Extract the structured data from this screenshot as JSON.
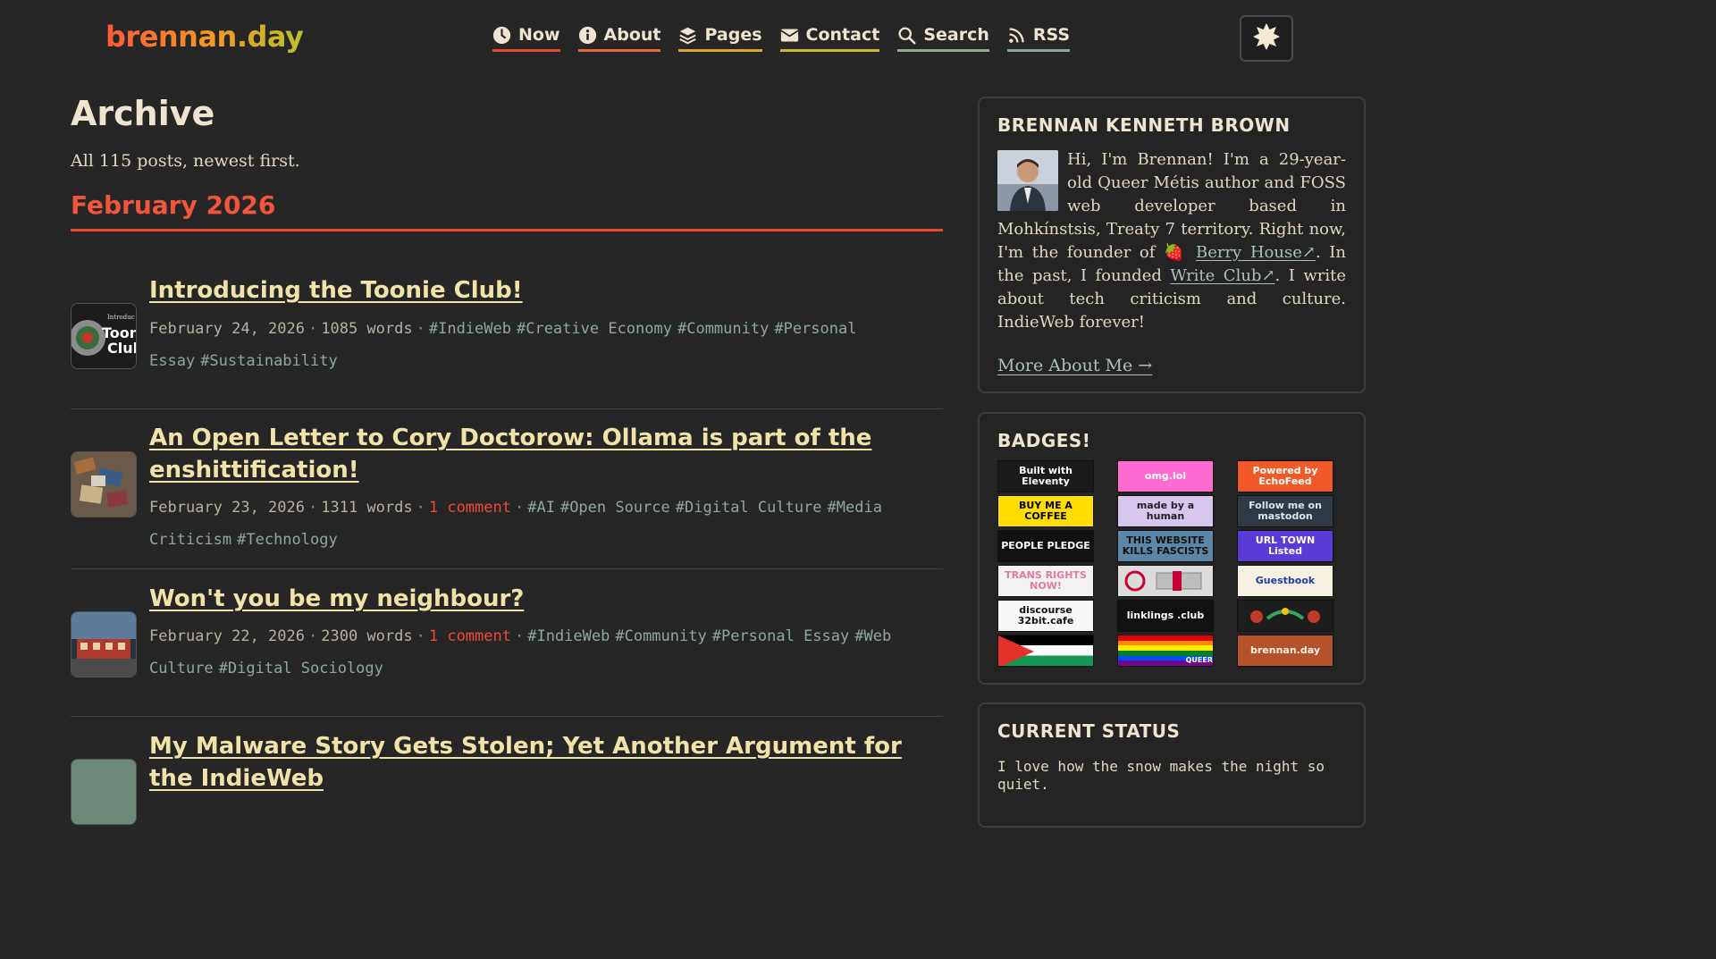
{
  "site": {
    "logo": "brennan.day"
  },
  "nav": [
    {
      "label": "Now",
      "icon": "clock-icon",
      "color": "#e8492d"
    },
    {
      "label": "About",
      "icon": "info-icon",
      "color": "#e8692d"
    },
    {
      "label": "Pages",
      "icon": "layers-icon",
      "color": "#e0a52b"
    },
    {
      "label": "Contact",
      "icon": "envelope-icon",
      "color": "#c6b92f"
    },
    {
      "label": "Search",
      "icon": "search-icon",
      "color": "#8fb08a"
    },
    {
      "label": "RSS",
      "icon": "rss-icon",
      "color": "#8aa6a2"
    }
  ],
  "theme_toggle": {
    "icon": "sun-icon"
  },
  "archive": {
    "title": "Archive",
    "intro": "All 115 posts, newest first.",
    "month": "February 2026",
    "posts": [
      {
        "title": "Introducing the Toonie Club!",
        "date": "February 24, 2026",
        "words": "1085 words",
        "comment": "",
        "tags": [
          "#IndieWeb",
          "#Creative Economy",
          "#Community",
          "#Personal Essay",
          "#Sustainability"
        ],
        "thumb_text": "Toon Club"
      },
      {
        "title": "An Open Letter to Cory Doctorow: Ollama is part of the enshittification!",
        "date": "February 23, 2026",
        "words": "1311 words",
        "comment": "1 comment",
        "tags": [
          "#AI",
          "#Open Source",
          "#Digital Culture",
          "#Media Criticism",
          "#Technology"
        ],
        "thumb_text": ""
      },
      {
        "title": "Won't you be my neighbour?",
        "date": "February 22, 2026",
        "words": "2300 words",
        "comment": "1 comment",
        "tags": [
          "#IndieWeb",
          "#Community",
          "#Personal Essay",
          "#Web Culture",
          "#Digital Sociology"
        ],
        "thumb_text": ""
      },
      {
        "title": "My Malware Story Gets Stolen; Yet Another Argument for the IndieWeb",
        "date": "",
        "words": "",
        "comment": "",
        "tags": [],
        "thumb_text": ""
      }
    ]
  },
  "sidebar": {
    "about": {
      "title": "BRENNAN KENNETH BROWN",
      "bio_1": "Hi, I'm Brennan! I'm a 29-year-old Queer Métis author and FOSS web developer based in Mohkínstsis, Treaty 7 territory. Right now, I'm the founder of ",
      "berry_emoji": "🍓",
      "berry_link": "Berry House↗",
      "bio_2": ". In the past, I founded ",
      "write_link": "Write Club↗",
      "bio_3": ". I write about tech criticism and culture. IndieWeb forever!",
      "more_link": "More About Me →"
    },
    "badges": {
      "title": "BADGES!",
      "items": [
        {
          "label": "Built with Eleventy",
          "bg": "#1a1a1a",
          "fg": "#ffffff"
        },
        {
          "label": "omg.lol",
          "bg": "#ff6bd0",
          "fg": "#ffffff"
        },
        {
          "label": "Powered by EchoFeed",
          "bg": "#f05a28",
          "fg": "#ffffff"
        },
        {
          "label": "BUY ME A COFFEE",
          "bg": "#ffdd00",
          "fg": "#000000"
        },
        {
          "label": "made by a human",
          "bg": "#d7c6ee",
          "fg": "#222222"
        },
        {
          "label": "Follow me on mastodon",
          "bg": "#2f3a44",
          "fg": "#dbe6ee"
        },
        {
          "label": "PEOPLE PLEDGE",
          "bg": "#111111",
          "fg": "#ffffff"
        },
        {
          "label": "THIS WEBSITE KILLS FASCISTS",
          "bg": "#5b86a8",
          "fg": "#111111"
        },
        {
          "label": "URL TOWN Listed",
          "bg": "#5a3bd6",
          "fg": "#ffffff"
        },
        {
          "label": "TRANS RIGHTS NOW!",
          "bg": "#f2f2f2",
          "fg": "#e07aa0"
        },
        {
          "label": "",
          "bg": "#dcdcdc",
          "fg": "#b01c3a"
        },
        {
          "label": "Guestbook",
          "bg": "#f5f0e0",
          "fg": "#1f3ea8"
        },
        {
          "label": "discourse 32bit.cafe",
          "bg": "#f8f8f8",
          "fg": "#111111"
        },
        {
          "label": "linklings .club",
          "bg": "#111111",
          "fg": "#ffffff"
        },
        {
          "label": "",
          "bg": "#1d1d1d",
          "fg": "#ffffff"
        },
        {
          "label": "",
          "bg": "#ffffff",
          "fg": "#000000"
        },
        {
          "label": "QUEER",
          "bg": "#7b2fd0",
          "fg": "#ffffff"
        },
        {
          "label": "brennan.day",
          "bg": "#b3522b",
          "fg": "#fff5e0"
        }
      ]
    },
    "status": {
      "title": "CURRENT STATUS",
      "text": "I love how the snow makes the night so quiet."
    }
  }
}
